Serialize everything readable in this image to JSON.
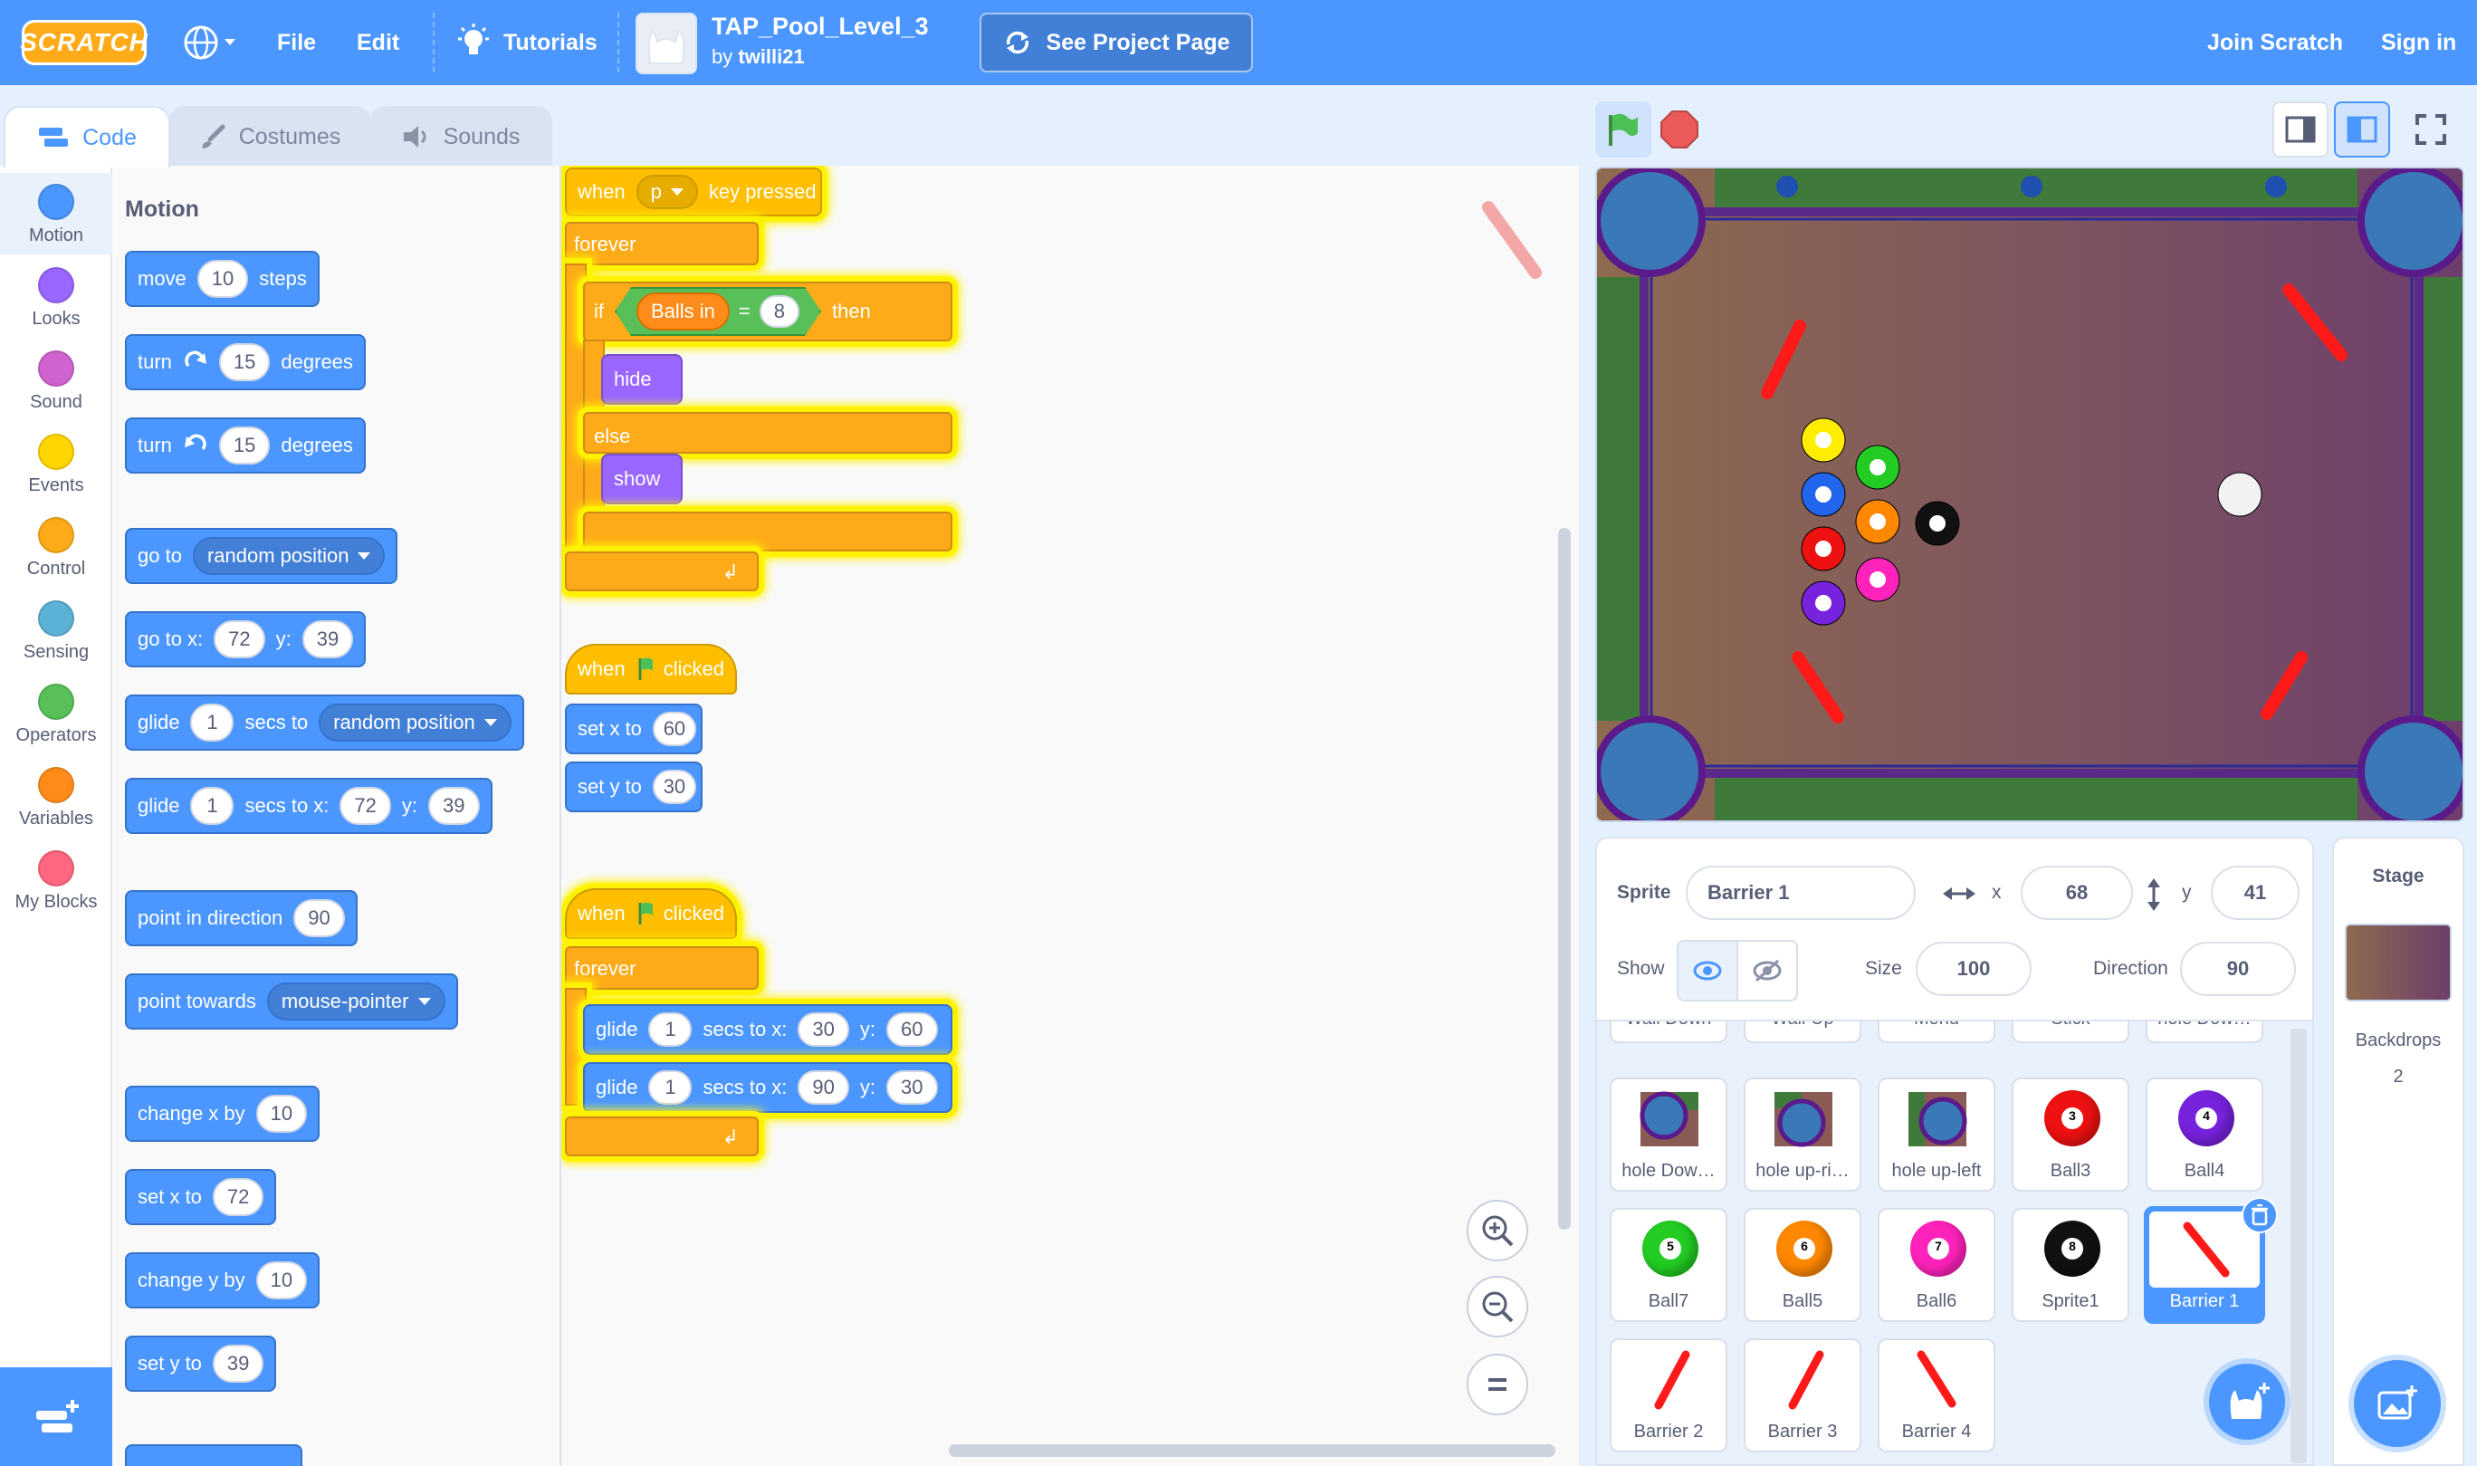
{
  "menubar": {
    "logo": "SCRATCH",
    "file": "File",
    "edit": "Edit",
    "tutorials": "Tutorials",
    "project_title": "TAP_Pool_Level_3",
    "by_prefix": "by",
    "author": "twilli21",
    "see_project": "See Project Page",
    "join": "Join Scratch",
    "signin": "Sign in"
  },
  "tabs": {
    "code": "Code",
    "costumes": "Costumes",
    "sounds": "Sounds"
  },
  "categories": [
    {
      "label": "Motion",
      "color": "#4c97ff"
    },
    {
      "label": "Looks",
      "color": "#9966ff"
    },
    {
      "label": "Sound",
      "color": "#cf63cf"
    },
    {
      "label": "Events",
      "color": "#ffd500"
    },
    {
      "label": "Control",
      "color": "#ffab19"
    },
    {
      "label": "Sensing",
      "color": "#5cb1d6"
    },
    {
      "label": "Operators",
      "color": "#59c059"
    },
    {
      "label": "Variables",
      "color": "#ff8c1a"
    },
    {
      "label": "My Blocks",
      "color": "#ff6680"
    }
  ],
  "palette": {
    "title": "Motion",
    "move": {
      "a": "move",
      "v": "10",
      "b": "steps"
    },
    "turn_right": {
      "a": "turn",
      "v": "15",
      "b": "degrees"
    },
    "turn_left": {
      "a": "turn",
      "v": "15",
      "b": "degrees"
    },
    "goto": {
      "a": "go to",
      "dd": "random position"
    },
    "gotoxy": {
      "a": "go to x:",
      "x": "72",
      "yl": "y:",
      "y": "39"
    },
    "glide_to": {
      "a": "glide",
      "v": "1",
      "b": "secs to",
      "dd": "random position"
    },
    "glide_xy": {
      "a": "glide",
      "v": "1",
      "b": "secs to x:",
      "x": "72",
      "yl": "y:",
      "y": "39"
    },
    "point_dir": {
      "a": "point in direction",
      "v": "90"
    },
    "point_towards": {
      "a": "point towards",
      "dd": "mouse-pointer"
    },
    "change_x": {
      "a": "change x by",
      "v": "10"
    },
    "set_x": {
      "a": "set x to",
      "v": "72"
    },
    "change_y": {
      "a": "change y by",
      "v": "10"
    },
    "set_y": {
      "a": "set y to",
      "v": "39"
    }
  },
  "script1": {
    "when": "when",
    "key": "p",
    "key_pressed": "key pressed",
    "forever": "forever",
    "if": "if",
    "var": "Balls in",
    "eq": "=",
    "num": "8",
    "then": "then",
    "hide": "hide",
    "else": "else",
    "show": "show"
  },
  "script2": {
    "when": "when",
    "clicked": "clicked",
    "setx": "set x to",
    "x": "60",
    "sety": "set y to",
    "y": "30"
  },
  "script3": {
    "when": "when",
    "clicked": "clicked",
    "forever": "forever",
    "g1": {
      "a": "glide",
      "v": "1",
      "b": "secs to x:",
      "x": "30",
      "yl": "y:",
      "y": "60"
    },
    "g2": {
      "a": "glide",
      "v": "1",
      "b": "secs to x:",
      "x": "90",
      "yl": "y:",
      "y": "30"
    }
  },
  "stage": {
    "balls": [
      {
        "n": "1",
        "color": "#ffee00"
      },
      {
        "n": "5",
        "color": "#22cc22"
      },
      {
        "n": "2",
        "color": "#2266ee"
      },
      {
        "n": "6",
        "color": "#ff8800"
      },
      {
        "n": "8",
        "color": "#111111"
      },
      {
        "n": "3",
        "color": "#ee1111"
      },
      {
        "n": "7",
        "color": "#ff22bb"
      },
      {
        "n": "4",
        "color": "#7722dd"
      }
    ]
  },
  "sprite_info": {
    "sprite_label": "Sprite",
    "name": "Barrier 1",
    "x_label": "x",
    "x": "68",
    "y_label": "y",
    "y": "41",
    "show_label": "Show",
    "size_label": "Size",
    "size": "100",
    "direction_label": "Direction",
    "direction": "90"
  },
  "sprites_top_row": [
    "Wall Down",
    "Wall Up",
    "Menu",
    "Stick",
    "hole Dow…"
  ],
  "sprites": [
    {
      "name": "hole Dow…"
    },
    {
      "name": "hole up-ri…"
    },
    {
      "name": "hole up-left"
    },
    {
      "name": "Ball3",
      "ball": "3",
      "color": "#ee1111"
    },
    {
      "name": "Ball4",
      "ball": "4",
      "color": "#7722dd"
    },
    {
      "name": "Ball7",
      "ball": "5",
      "color": "#22cc22"
    },
    {
      "name": "Ball5",
      "ball": "6",
      "color": "#ff8800"
    },
    {
      "name": "Ball6",
      "ball": "7",
      "color": "#ff22bb"
    },
    {
      "name": "Sprite1",
      "ball": "8",
      "color": "#111111"
    },
    {
      "name": "Barrier 1"
    },
    {
      "name": "Barrier 2"
    },
    {
      "name": "Barrier 3"
    },
    {
      "name": "Barrier 4"
    }
  ],
  "stage_panel": {
    "title": "Stage",
    "backdrops_label": "Backdrops",
    "backdrops_count": "2"
  }
}
